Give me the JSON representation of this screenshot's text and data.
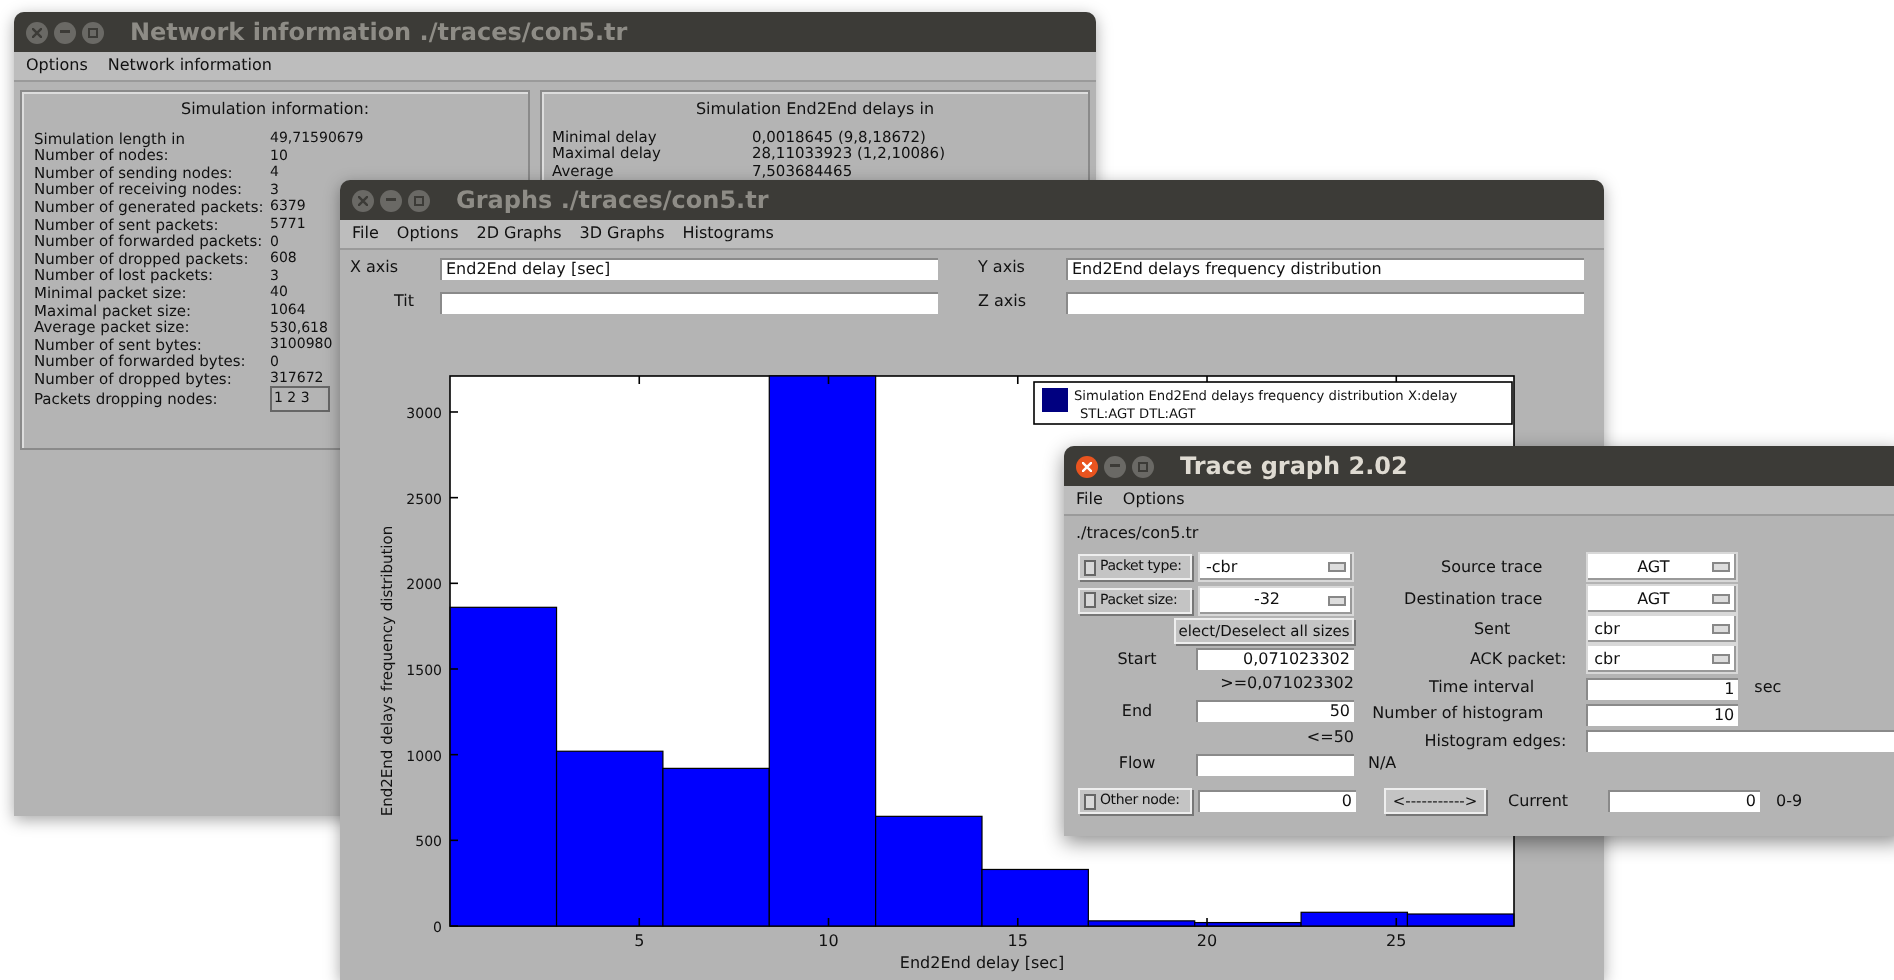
{
  "network_window": {
    "title": "Network information  ./traces/con5.tr",
    "active": false,
    "menu": [
      "Options",
      "Network information"
    ],
    "simulation_info": {
      "heading": "Simulation information:",
      "rows": [
        {
          "label": "Simulation length in",
          "value": "49,71590679"
        },
        {
          "label": "Number of nodes:",
          "value": "10"
        },
        {
          "label": "Number of sending nodes:",
          "value": "4"
        },
        {
          "label": "Number of receiving nodes:",
          "value": "3"
        },
        {
          "label": "Number of generated packets:",
          "value": "6379"
        },
        {
          "label": "Number of sent packets:",
          "value": "5771"
        },
        {
          "label": "Number of forwarded packets:",
          "value": "0"
        },
        {
          "label": "Number of dropped packets:",
          "value": "608"
        },
        {
          "label": "Number of lost packets:",
          "value": "3"
        },
        {
          "label": "Minimal packet size:",
          "value": "40"
        },
        {
          "label": "Maximal packet size:",
          "value": "1064"
        },
        {
          "label": "Average packet size:",
          "value": "530,618"
        },
        {
          "label": "Number of sent bytes:",
          "value": "3100980"
        },
        {
          "label": "Number of forwarded bytes:",
          "value": "0"
        },
        {
          "label": "Number of dropped bytes:",
          "value": "317672"
        }
      ],
      "dropping_nodes": {
        "label": "Packets dropping nodes:",
        "value": "1  2  3"
      }
    },
    "delays": {
      "heading": "Simulation End2End delays in",
      "rows": [
        {
          "label": "Minimal delay",
          "value": "0,0018645 (9,8,18672)"
        },
        {
          "label": "Maximal delay",
          "value": "28,11033923 (1,2,10086)"
        },
        {
          "label": "Average",
          "value": "7,503684465"
        }
      ]
    }
  },
  "graphs_window": {
    "title": "Graphs  ./traces/con5.tr",
    "active": false,
    "menu": [
      "File",
      "Options",
      "2D Graphs",
      "3D Graphs",
      "Histograms"
    ],
    "x_axis": {
      "label": "X axis",
      "value": "End2End delay [sec]"
    },
    "y_axis": {
      "label": "Y axis",
      "value": "End2End delays frequency distribution"
    },
    "tit": {
      "label": "Tit"
    },
    "z_axis": {
      "label": "Z axis"
    },
    "legend_note": "STL:AGT DTL:AGT",
    "chart_data": {
      "type": "bar",
      "xlabel": "End2End delay [sec]",
      "ylabel": "End2End delays frequency distribution",
      "x": [
        1.41,
        4.22,
        7.03,
        9.84,
        12.65,
        15.46,
        18.27,
        21.08,
        23.89,
        26.7
      ],
      "series": [
        {
          "name": "Simulation End2End delays frequency distribution X:delay",
          "color": "#0000ff",
          "values": [
            1860,
            1020,
            920,
            3210,
            640,
            330,
            30,
            20,
            80,
            70
          ]
        }
      ],
      "xlim": [
        0,
        28.11
      ],
      "ylim": [
        0,
        3210
      ],
      "xticks": [
        5,
        10,
        15,
        20,
        25
      ],
      "yticks": [
        0,
        500,
        1000,
        1500,
        2000,
        2500,
        3000
      ]
    }
  },
  "trace_window": {
    "title": "Trace graph 2.02",
    "active": true,
    "menu": [
      "File",
      "Options"
    ],
    "path": "./traces/con5.tr",
    "packet_type": {
      "label": "Packet type:",
      "checked": false,
      "value": "-cbr"
    },
    "packet_size": {
      "label": "Packet size:",
      "checked": false,
      "value": "-32"
    },
    "select_all_button": "elect/Deselect all sizes",
    "start": {
      "label": "Start",
      "value": "0,071023302",
      "hint": ">=0,071023302"
    },
    "end": {
      "label": "End",
      "value": "50",
      "hint": "<=50"
    },
    "flow": {
      "label": "Flow",
      "note": "N/A"
    },
    "other_node": {
      "label": "Other node:",
      "checked": false,
      "value": "0"
    },
    "source_trace": {
      "label": "Source trace",
      "value": "AGT"
    },
    "destination_trace": {
      "label": "Destination trace",
      "value": "AGT"
    },
    "sent": {
      "label": "Sent",
      "value": "cbr"
    },
    "ack_packet": {
      "label": "ACK packet:",
      "value": "cbr"
    },
    "time_interval": {
      "label": "Time interval",
      "value": "1",
      "unit": "sec"
    },
    "number_of_histogram": {
      "label": "Number of histogram",
      "value": "10"
    },
    "histogram_edges": {
      "label": "Histogram edges:"
    },
    "step_button": "<----------->",
    "current": {
      "label": "Current",
      "value": "0",
      "range": "0-9"
    }
  }
}
